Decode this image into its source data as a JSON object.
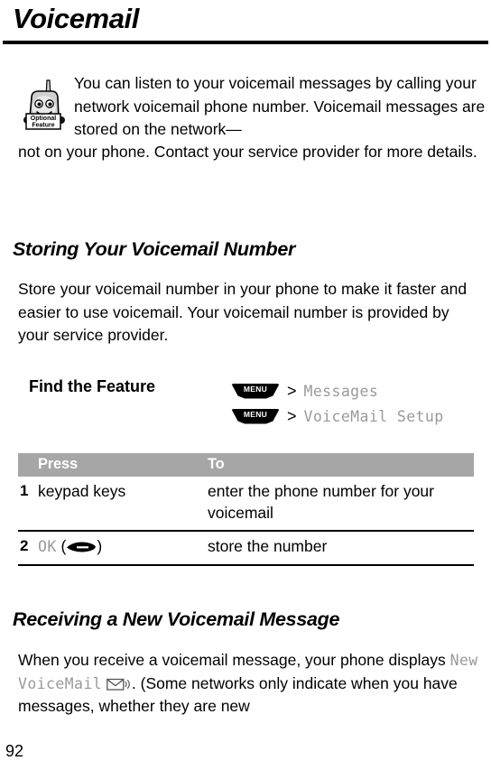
{
  "page": {
    "title": "Voicemail",
    "number": "92"
  },
  "note": {
    "icon_label_line1": "Optional",
    "icon_label_line2": "Feature",
    "text_part1": "You can listen to your voicemail messages by calling your network voicemail phone number. Voicemail messages are stored on the network—",
    "text_part2": "not on your phone. Contact your service provider for more details."
  },
  "sections": {
    "storing": {
      "heading": "Storing Your Voicemail Number",
      "paragraph": "Store your voicemail number in your phone to make it faster and easier to use voicemail. Your voicemail number is provided by your service provider."
    },
    "receiving": {
      "heading": "Receiving a New Voicemail Message",
      "paragraph_before": "When you receive a voicemail message, your phone displays ",
      "display_text": "New VoiceMail",
      "paragraph_after": ". (Some networks only indicate when you have messages, whether they are new"
    }
  },
  "find_the_feature": {
    "label": "Find the Feature",
    "paths": [
      {
        "key": "MENU",
        "separator": ">",
        "target": "Messages"
      },
      {
        "key": "MENU",
        "separator": ">",
        "target": "VoiceMail Setup"
      }
    ]
  },
  "steps_table": {
    "headers": {
      "press": "Press",
      "to": "To"
    },
    "rows": [
      {
        "num": "1",
        "press": "keypad keys",
        "to": "enter the phone number for your voicemail"
      },
      {
        "num": "2",
        "press_key": "OK",
        "press_paren_open": "(",
        "press_paren_close": ")",
        "to": "store the number"
      }
    ]
  },
  "colors": {
    "table_header_bg": "#a6a6a6",
    "mono_gray": "#9a9a9a",
    "rule": "#000000"
  }
}
